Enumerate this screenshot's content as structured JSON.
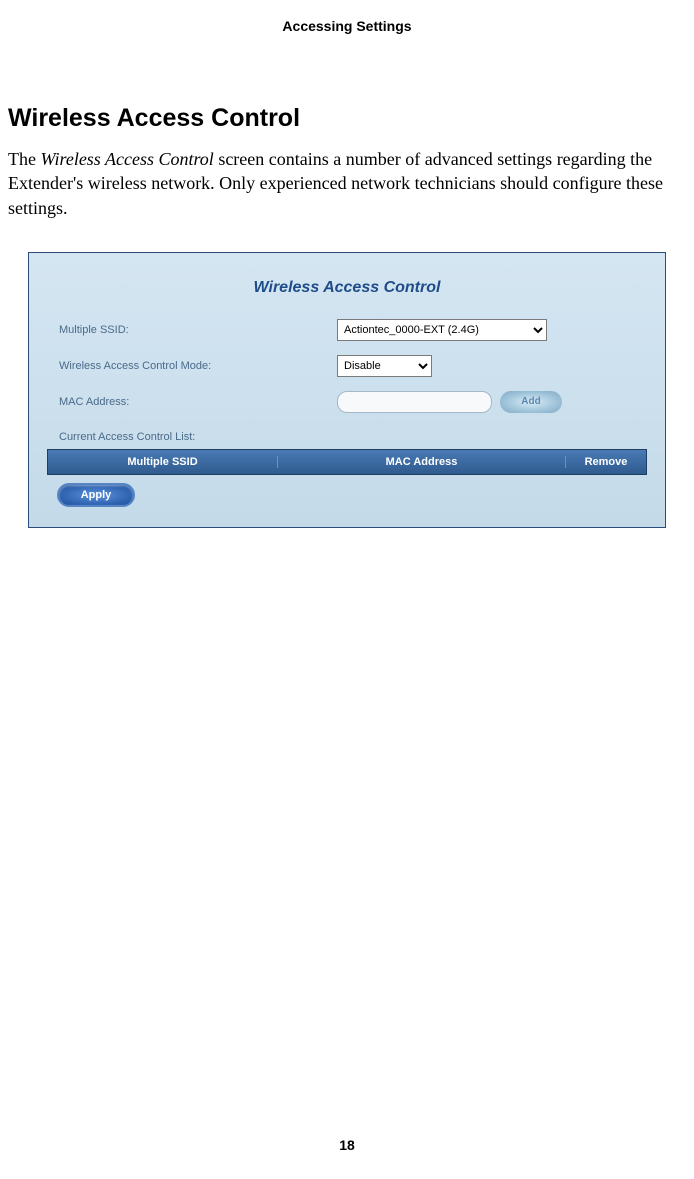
{
  "header": {
    "chapter_title": "Accessing Settings"
  },
  "section": {
    "heading": "Wireless Access Control",
    "paragraph_prefix": "The ",
    "paragraph_italic": "Wireless Access Control",
    "paragraph_suffix": " screen contains a number of advanced settings regarding the Extender's wireless network. Only experienced network technicians should configure these settings."
  },
  "panel": {
    "title": "Wireless Access Control",
    "fields": {
      "multiple_ssid": {
        "label": "Multiple SSID:",
        "value": "Actiontec_0000-EXT (2.4G)"
      },
      "access_mode": {
        "label": "Wireless Access Control Mode:",
        "value": "Disable"
      },
      "mac_address": {
        "label": "MAC Address:",
        "value": "",
        "add_btn": "Add"
      }
    },
    "list_label": "Current Access Control List:",
    "table_headers": {
      "ssid": "Multiple SSID",
      "mac": "MAC Address",
      "remove": "Remove"
    },
    "apply_btn": "Apply"
  },
  "page_number": "18"
}
